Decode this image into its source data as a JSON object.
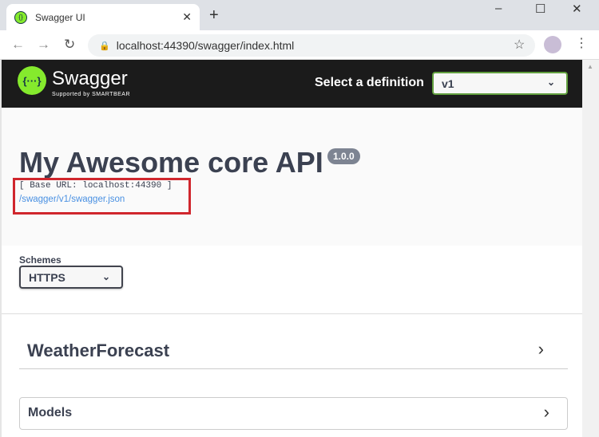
{
  "browser": {
    "tab_title": "Swagger UI",
    "url": "localhost:44390/swagger/index.html"
  },
  "header": {
    "brand": "Swagger",
    "tagline": "Supported by SMARTBEAR",
    "logo_glyph": "{···}",
    "definition_label": "Select a definition",
    "definition_value": "v1"
  },
  "info": {
    "title": "My Awesome core API",
    "version": "1.0.0",
    "base_url": "[ Base URL: localhost:44390 ]",
    "spec_link": "/swagger/v1/swagger.json"
  },
  "schemes": {
    "label": "Schemes",
    "value": "HTTPS"
  },
  "sections": {
    "tag": "WeatherForecast",
    "models": "Models"
  },
  "colors": {
    "accent": "#85ea2d",
    "topbar": "#1b1b1b",
    "highlight": "#d0262d",
    "link": "#4990e2"
  }
}
